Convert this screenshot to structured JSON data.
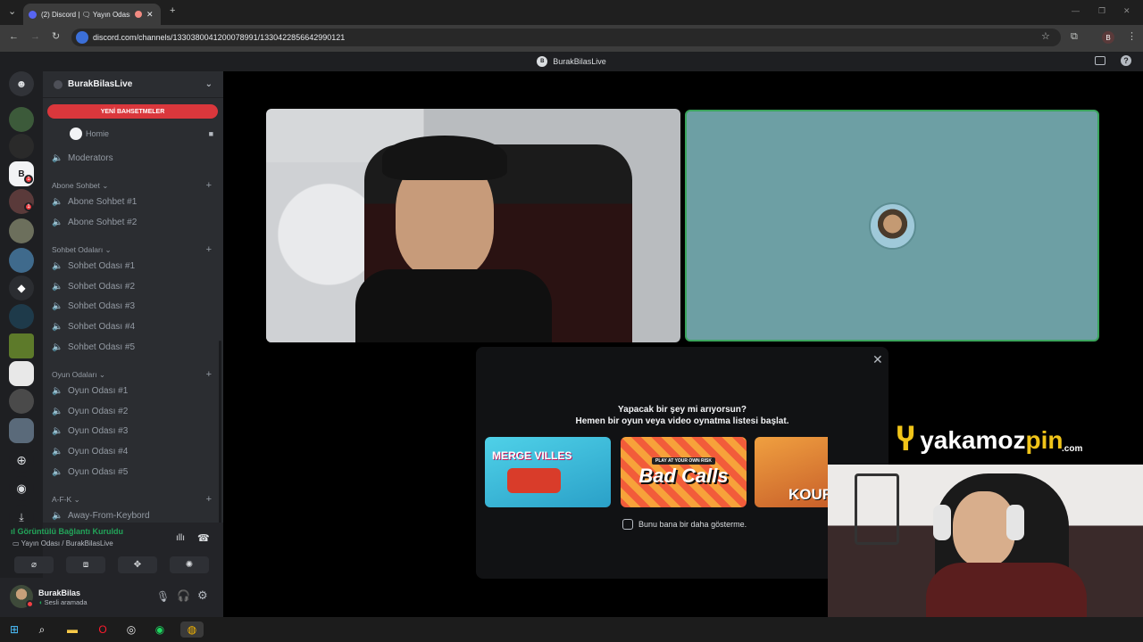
{
  "browser": {
    "tab_title": "(2) Discord | 🗨 Yayın Odası",
    "url": "discord.com/channels/1330380041200078991/1330422856642990121",
    "profile_initial": "B"
  },
  "discord": {
    "window_title": "BurakBilasLive",
    "server_name": "BurakBilasLive",
    "new_mentions": "YENİ BAHSETMELER",
    "channels_top": [
      {
        "name": "Homie"
      },
      {
        "name": "Moderators"
      }
    ],
    "categories": [
      {
        "name": "Abone Sohbet",
        "channels": [
          "Abone Sohbet #1",
          "Abone Sohbet #2"
        ]
      },
      {
        "name": "Sohbet Odaları",
        "channels": [
          "Sohbet Odası #1",
          "Sohbet Odası #2",
          "Sohbet Odası #3",
          "Sohbet Odası #4",
          "Sohbet Odası #5"
        ]
      },
      {
        "name": "Oyun Odaları",
        "channels": [
          "Oyun Odası #1",
          "Oyun Odası #2",
          "Oyun Odası #3",
          "Oyun Odası #4",
          "Oyun Odası #5"
        ]
      },
      {
        "name": "A-F-K",
        "channels": [
          "Away-From-Keybord"
        ]
      }
    ],
    "rail_badges": [
      "1",
      "1"
    ],
    "voice": {
      "status": "Görüntülü Bağlantı Kuruldu",
      "location": "Yayın Odası / BurakBilasLive"
    },
    "user": {
      "name": "BurakBilas",
      "status": "Sesli aramada"
    },
    "popup": {
      "title_line1": "Yapacak bir şey mi arıyorsun?",
      "title_line2": "Hemen bir oyun veya video oynatma listesi başlat.",
      "games": [
        "MERGE VILLES",
        "Bad Calls",
        "KOUR"
      ],
      "game_caption": "PLAY AT YOUR OWN RISK",
      "checkbox_label": "Bunu bana bir daha gösterme."
    }
  },
  "overlay": {
    "logo_main": "yakamoz",
    "logo_accent": "pin",
    "logo_suffix": ".com"
  },
  "colors": {
    "accent_red": "#da373c",
    "voice_green": "#23a55a",
    "tile_teal": "#6d9fa4",
    "logo_yellow": "#f0c419"
  }
}
